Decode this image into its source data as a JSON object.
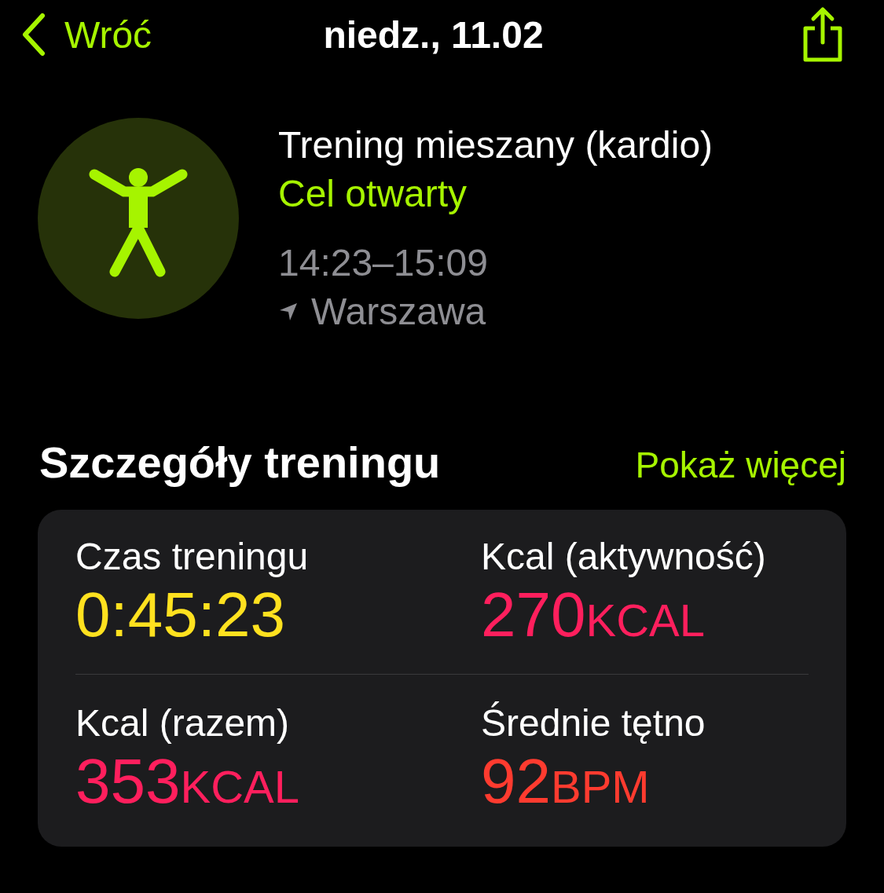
{
  "nav": {
    "back": "Wróć",
    "title": "niedz., 11.02"
  },
  "workout": {
    "name": "Trening mieszany (kardio)",
    "goal": "Cel otwarty",
    "time": "14:23–15:09",
    "location": "Warszawa"
  },
  "section": {
    "title": "Szczegóły treningu",
    "more": "Pokaż więcej"
  },
  "metrics": [
    {
      "label": "Czas treningu",
      "value": "0:45:23",
      "color": "#ffe11f"
    },
    {
      "label": "Kcal (aktywność)",
      "value": "270",
      "unit": "KCAL",
      "color": "#ff1f5d"
    },
    {
      "label": "Kcal (razem)",
      "value": "353",
      "unit": "KCAL",
      "color": "#ff1f5d"
    },
    {
      "label": "Średnie tętno",
      "value": "92",
      "unit": "BPM",
      "color": "#ff3b2f"
    }
  ]
}
